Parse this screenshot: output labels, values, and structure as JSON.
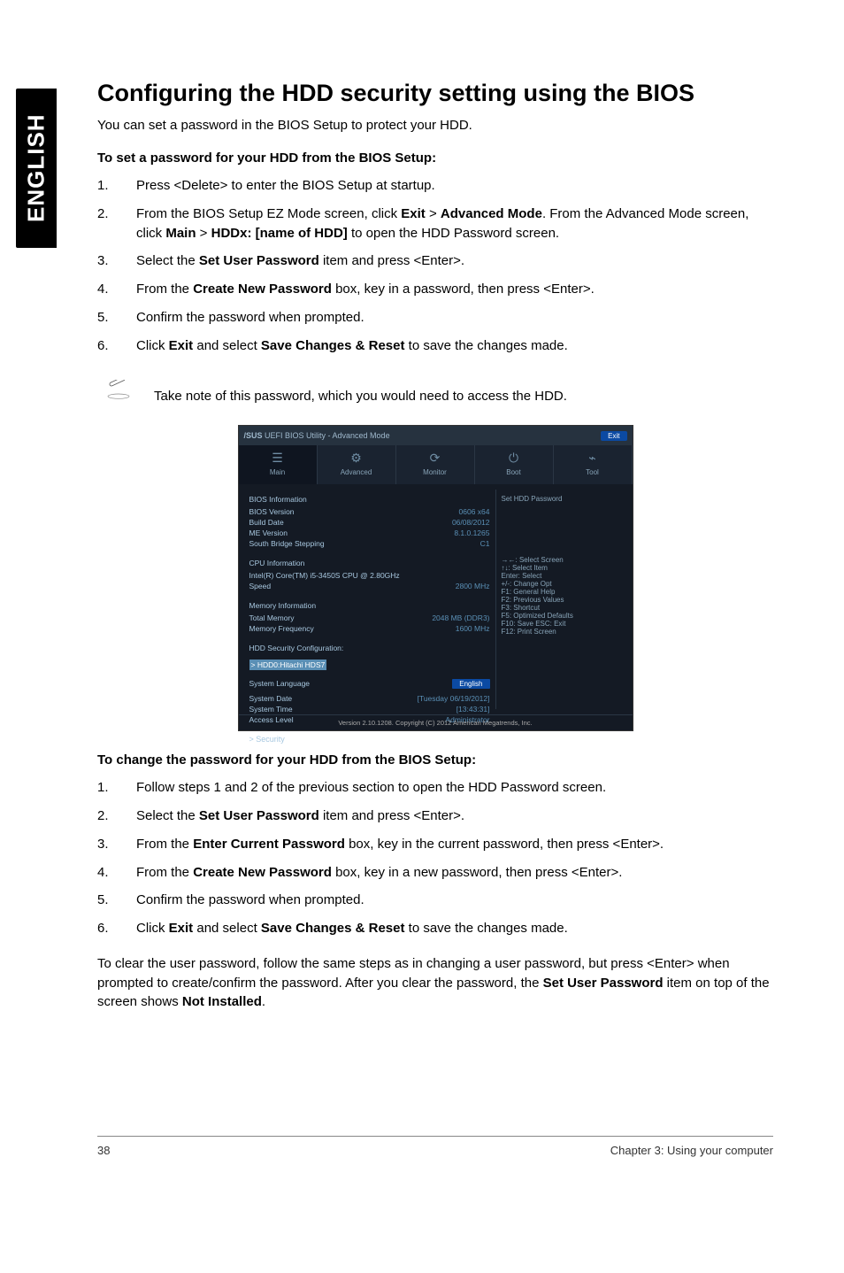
{
  "sidebar_label": "ENGLISH",
  "heading": "Configuring the HDD security setting using the BIOS",
  "intro": "You can set a password in the BIOS Setup to protect your HDD.",
  "set_label": "To set a password for your HDD from the BIOS Setup:",
  "set_steps": [
    {
      "n": "1.",
      "parts": [
        "Press <Delete> to enter the BIOS Setup at startup."
      ]
    },
    {
      "n": "2.",
      "parts": [
        "From the BIOS Setup EZ Mode screen, click ",
        "Exit",
        " > ",
        "Advanced Mode",
        ". From the Advanced Mode screen, click ",
        "Main",
        " > ",
        "HDDx: [name of HDD]",
        " to open the HDD Password screen."
      ]
    },
    {
      "n": "3.",
      "parts": [
        "Select the ",
        "Set User Password",
        " item and press <Enter>."
      ]
    },
    {
      "n": "4.",
      "parts": [
        "From the ",
        "Create New Password",
        " box, key in a password, then press <Enter>."
      ]
    },
    {
      "n": "5.",
      "parts": [
        "Confirm the password when prompted."
      ]
    },
    {
      "n": "6.",
      "parts": [
        "Click ",
        "Exit",
        " and select ",
        "Save Changes & Reset",
        " to save the changes made."
      ]
    }
  ],
  "note_text": "Take note of this password, which you would need to access the HDD.",
  "screenshot": {
    "brand": "/SUS",
    "title_rest": " UEFI BIOS Utility - Advanced Mode",
    "exit_label": "Exit",
    "tabs": [
      "Main",
      "Advanced",
      "Monitor",
      "Boot",
      "Tool"
    ],
    "bios_info_heading": "BIOS Information",
    "bios_info": [
      {
        "k": "BIOS Version",
        "v": "0606 x64"
      },
      {
        "k": "Build Date",
        "v": "06/08/2012"
      },
      {
        "k": "ME Version",
        "v": "8.1.0.1265"
      },
      {
        "k": "South Bridge Stepping",
        "v": "C1"
      }
    ],
    "cpu_info_heading": "CPU Information",
    "cpu_info": [
      {
        "k": "Intel(R) Core(TM) i5-3450S CPU @ 2.80GHz",
        "v": ""
      },
      {
        "k": "Speed",
        "v": "2800 MHz"
      }
    ],
    "mem_info_heading": "Memory Information",
    "mem_info": [
      {
        "k": "Total Memory",
        "v": "2048 MB (DDR3)"
      },
      {
        "k": "Memory Frequency",
        "v": "1600 MHz"
      }
    ],
    "hdd_conf_heading": "HDD Security Configuration:",
    "hdd_item": "> HDD0:Hitachi HDS7",
    "sys_lang_label": "System Language",
    "sys_lang_value": "English",
    "bottom": [
      {
        "k": "System Date",
        "v": "[Tuesday 06/19/2012]"
      },
      {
        "k": "System Time",
        "v": "[13:43:31]"
      },
      {
        "k": "Access Level",
        "v": "Administrator"
      }
    ],
    "security_item": "> Security",
    "right_title": "Set HDD Password",
    "right_help": [
      "→←: Select Screen",
      "↑↓: Select Item",
      "Enter: Select",
      "+/-: Change Opt",
      "F1: General Help",
      "F2: Previous Values",
      "F3: Shortcut",
      "F5: Optimized Defaults",
      "F10: Save  ESC: Exit",
      "F12: Print Screen"
    ],
    "copyright": "Version 2.10.1208. Copyright (C) 2012 American Megatrends, Inc."
  },
  "change_label": "To change the password for your HDD from the BIOS Setup:",
  "change_steps": [
    {
      "n": "1.",
      "parts": [
        "Follow steps 1 and 2 of the previous section to open the HDD Password screen."
      ]
    },
    {
      "n": "2.",
      "parts": [
        "Select the ",
        "Set User Password",
        " item and press <Enter>."
      ]
    },
    {
      "n": "3.",
      "parts": [
        "From the ",
        "Enter Current Password",
        " box, key in the current password, then press <Enter>."
      ]
    },
    {
      "n": "4.",
      "parts": [
        "From the ",
        "Create New Password",
        " box, key in a new password, then press <Enter>."
      ]
    },
    {
      "n": "5.",
      "parts": [
        "Confirm the password when prompted."
      ]
    },
    {
      "n": "6.",
      "parts": [
        "Click ",
        "Exit",
        " and select ",
        "Save Changes & Reset",
        " to save the changes made."
      ]
    }
  ],
  "clearing": {
    "pre": "To clear the user password, follow the same steps as in changing a user password, but press <Enter> when prompted to create/confirm the password. After you clear the password, the ",
    "bold1": "Set User Password",
    "mid": " item on top of the screen shows ",
    "bold2": "Not Installed",
    "post": "."
  },
  "footer": {
    "page": "38",
    "chapter": "Chapter 3: Using your computer"
  }
}
